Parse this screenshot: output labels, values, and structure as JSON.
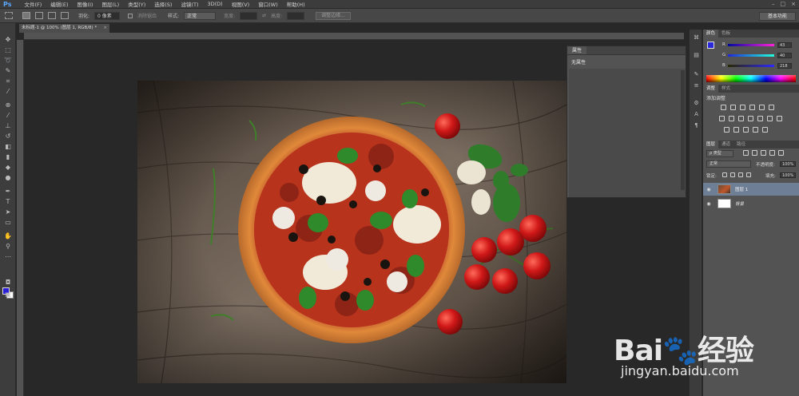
{
  "app": {
    "logo": "Ps"
  },
  "menu": [
    "文件(F)",
    "编辑(E)",
    "图像(I)",
    "图层(L)",
    "类型(Y)",
    "选择(S)",
    "滤镜(T)",
    "3D(D)",
    "视图(V)",
    "窗口(W)",
    "帮助(H)"
  ],
  "window_controls": {
    "minimize": "–",
    "maximize": "□",
    "close": "×"
  },
  "options": {
    "feather_label": "羽化:",
    "feather_value": "0 像素",
    "antialias_label": "消除锯齿",
    "style_label": "样式:",
    "style_value": "正常",
    "width_label": "宽度:",
    "height_label": "高度:",
    "refine_edge": "调整边缘...",
    "workspace": "基本功能"
  },
  "document": {
    "tab_title": "未标题-1 @ 100% (图层 1, RGB/8) *",
    "close": "×"
  },
  "properties": {
    "tab": "属性",
    "message": "无属性"
  },
  "color_panel": {
    "tabs": [
      "颜色",
      "色板"
    ],
    "channels": [
      {
        "label": "R",
        "value": "43",
        "color": "#ff2020"
      },
      {
        "label": "G",
        "value": "40",
        "color": "#20d020"
      },
      {
        "label": "B",
        "value": "218",
        "color": "#3040ff"
      }
    ],
    "fg_color": "#2b28da"
  },
  "adjustments": {
    "tabs": [
      "调整",
      "样式"
    ],
    "title": "添加调整"
  },
  "layers": {
    "tabs": [
      "图层",
      "通道",
      "路径"
    ],
    "filter_label": "ρ 类型",
    "blend_mode": "正常",
    "opacity_label": "不透明度:",
    "opacity_value": "100%",
    "lock_label": "锁定:",
    "fill_label": "填充:",
    "fill_value": "100%",
    "items": [
      {
        "name": "图层 1",
        "selected": true
      },
      {
        "name": "背景",
        "selected": false
      }
    ]
  },
  "watermark": {
    "brand": "Bai🐾经验",
    "url": "jingyan.baidu.com"
  }
}
